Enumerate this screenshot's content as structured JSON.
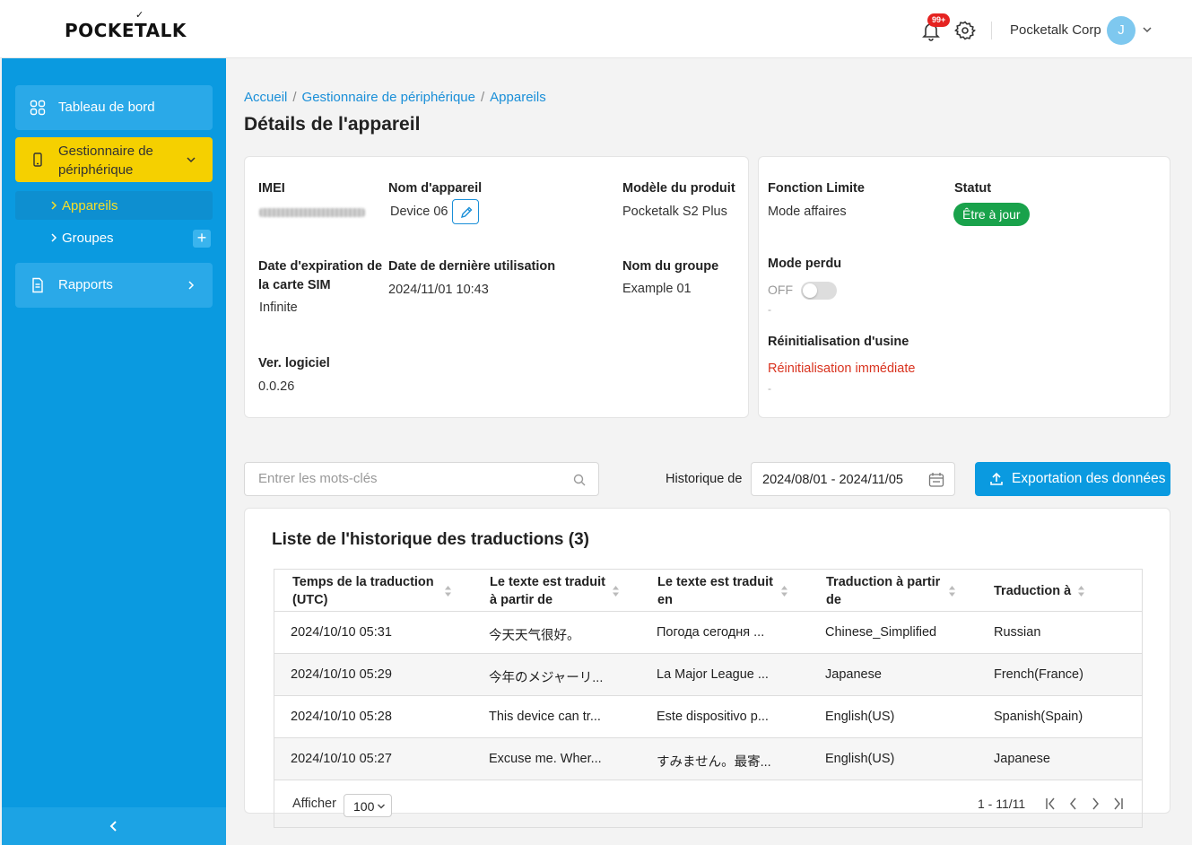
{
  "header": {
    "logo": "POCKETALK",
    "notification_badge": "99+",
    "company": "Pocketalk Corp",
    "avatar_initial": "J"
  },
  "sidebar": {
    "dashboard": "Tableau de bord",
    "device_manager": "Gestionnaire de périphérique",
    "devices": "Appareils",
    "groups": "Groupes",
    "reports": "Rapports"
  },
  "breadcrumb": {
    "home": "Accueil",
    "section": "Gestionnaire de périphérique",
    "current": "Appareils"
  },
  "page_title": "Détails de l'appareil",
  "device": {
    "imei_label": "IMEI",
    "name_label": "Nom d'appareil",
    "name_value": "Device 06",
    "model_label": "Modèle du produit",
    "model_value": "Pocketalk S2 Plus",
    "sim_label": "Date d'expiration de la carte SIM",
    "sim_value": "Infinite",
    "last_use_label": "Date de dernière utilisation",
    "last_use_value": "2024/11/01 10:43",
    "group_label": "Nom du groupe",
    "group_value": "Example 01",
    "software_label": "Ver. logiciel",
    "software_value": "0.0.26"
  },
  "function": {
    "limit_label": "Fonction Limite",
    "limit_value": "Mode affaires",
    "status_label": "Statut",
    "status_value": "Être à jour",
    "status_color": "#19a24b",
    "lost_label": "Mode perdu",
    "lost_value": "OFF",
    "lost_sub": "-",
    "reset_label": "Réinitialisation d'usine",
    "reset_action": "Réinitialisation immédiate",
    "reset_sub": "-"
  },
  "filters": {
    "search_placeholder": "Entrer les mots-clés",
    "history_label": "Historique de",
    "date_range": "2024/08/01 - 2024/11/05",
    "export_label": "Exportation des données"
  },
  "table": {
    "title": "Liste de l'historique des traductions (3)",
    "headers": [
      "Temps de la traduction (UTC)",
      "Le texte est traduit à partir de",
      "Le texte est traduit en",
      "Traduction à partir de",
      "Traduction à"
    ],
    "rows": [
      [
        "2024/10/10 05:31",
        "今天天气很好。",
        "Погода сегодня ...",
        "Chinese_Simplified",
        "Russian"
      ],
      [
        "2024/10/10 05:29",
        "今年のメジャーリ...",
        "La Major League ...",
        "Japanese",
        "French(France)"
      ],
      [
        "2024/10/10 05:28",
        "This device can tr...",
        "Este dispositivo p...",
        "English(US)",
        "Spanish(Spain)"
      ],
      [
        "2024/10/10 05:27",
        "Excuse me. Wher...",
        "すみません。最寄...",
        "English(US)",
        "Japanese"
      ]
    ],
    "show_label": "Afficher",
    "per_page": "100",
    "range": "1 - 11/11"
  },
  "colors": {
    "sidebar": "#0a9ae0",
    "active_item": "#f5d000",
    "link": "#1a8fd8",
    "danger": "#d9331f"
  }
}
